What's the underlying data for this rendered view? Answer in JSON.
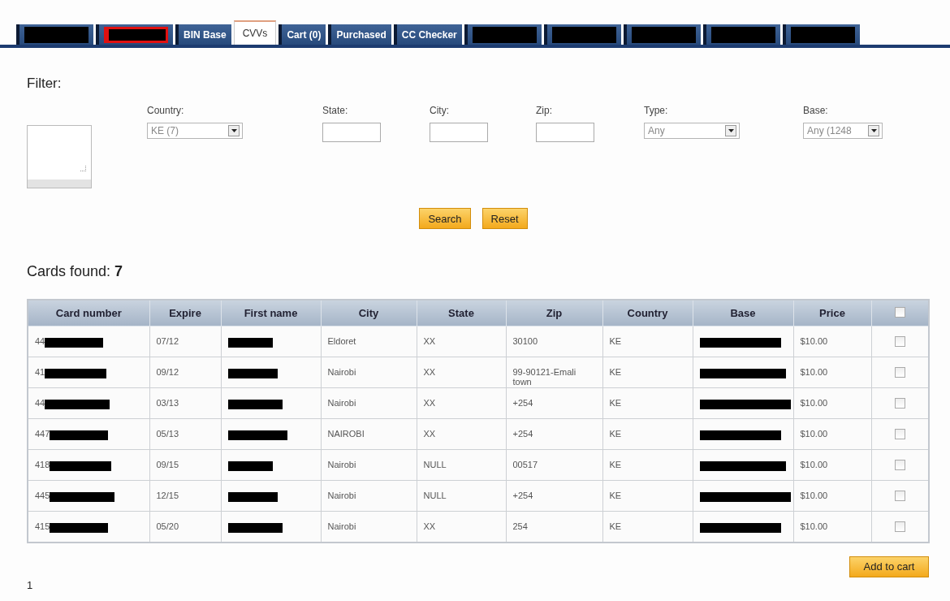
{
  "tabs": [
    {
      "kind": "redacted",
      "selected": false
    },
    {
      "kind": "redacted",
      "selected": false,
      "color": "#e01010"
    },
    {
      "kind": "label",
      "label": "BIN Base",
      "selected": false
    },
    {
      "kind": "label",
      "label": "CVVs",
      "selected": true
    },
    {
      "kind": "label",
      "label": "Cart (0)",
      "selected": false
    },
    {
      "kind": "label",
      "label": "Purchased",
      "selected": false
    },
    {
      "kind": "label",
      "label": "CC Checker",
      "selected": false
    },
    {
      "kind": "redacted",
      "selected": false
    },
    {
      "kind": "redacted",
      "selected": false
    },
    {
      "kind": "redacted",
      "selected": false
    },
    {
      "kind": "redacted",
      "selected": false
    },
    {
      "kind": "redacted",
      "selected": false
    }
  ],
  "filter": {
    "title": "Filter:",
    "fields": [
      {
        "kind": "select",
        "label": "Country:",
        "value": "KE (7)"
      },
      {
        "kind": "text",
        "label": "State:"
      },
      {
        "kind": "text",
        "label": "City:"
      },
      {
        "kind": "text",
        "label": "Zip:"
      },
      {
        "kind": "select",
        "label": "Type:",
        "value": "Any"
      },
      {
        "kind": "select",
        "label": "Base:",
        "value": "Any (1248"
      }
    ],
    "buttons": [
      "Search",
      "Reset"
    ]
  },
  "results": {
    "label": "Cards found:",
    "count": "7"
  },
  "table": {
    "columns": [
      "Card number",
      "Expire",
      "First name",
      "City",
      "State",
      "Zip",
      "Country",
      "Base",
      "Price"
    ],
    "header_checkbox": {
      "checked": false
    },
    "rows": [
      {
        "card_number": "44",
        "expire": "07/12",
        "city": "Eldoret",
        "state": "XX",
        "zip": "30100",
        "country": "KE",
        "price": "$10.00",
        "checked": false
      },
      {
        "card_number": "41",
        "expire": "09/12",
        "city": "Nairobi",
        "state": "XX",
        "zip": "99-90121-Emali town",
        "country": "KE",
        "price": "$10.00",
        "checked": false
      },
      {
        "card_number": "44",
        "expire": "03/13",
        "city": "Nairobi",
        "state": "XX",
        "zip": "+254",
        "country": "KE",
        "price": "$10.00",
        "checked": false
      },
      {
        "card_number": "447",
        "expire": "05/13",
        "city": "NAIROBI",
        "state": "XX",
        "zip": "+254",
        "country": "KE",
        "price": "$10.00",
        "checked": false
      },
      {
        "card_number": "418",
        "expire": "09/15",
        "city": "Nairobi",
        "state": "NULL",
        "zip": "00517",
        "country": "KE",
        "price": "$10.00",
        "checked": false
      },
      {
        "card_number": "445",
        "expire": "12/15",
        "city": "Nairobi",
        "state": "NULL",
        "zip": "+254",
        "country": "KE",
        "price": "$10.00",
        "checked": false
      },
      {
        "card_number": "415",
        "expire": "05/20",
        "city": "Nairobi",
        "state": "XX",
        "zip": "254",
        "country": "KE",
        "price": "$10.00",
        "checked": false
      }
    ]
  },
  "add_button": "Add to cart",
  "pagination": [
    "1"
  ]
}
